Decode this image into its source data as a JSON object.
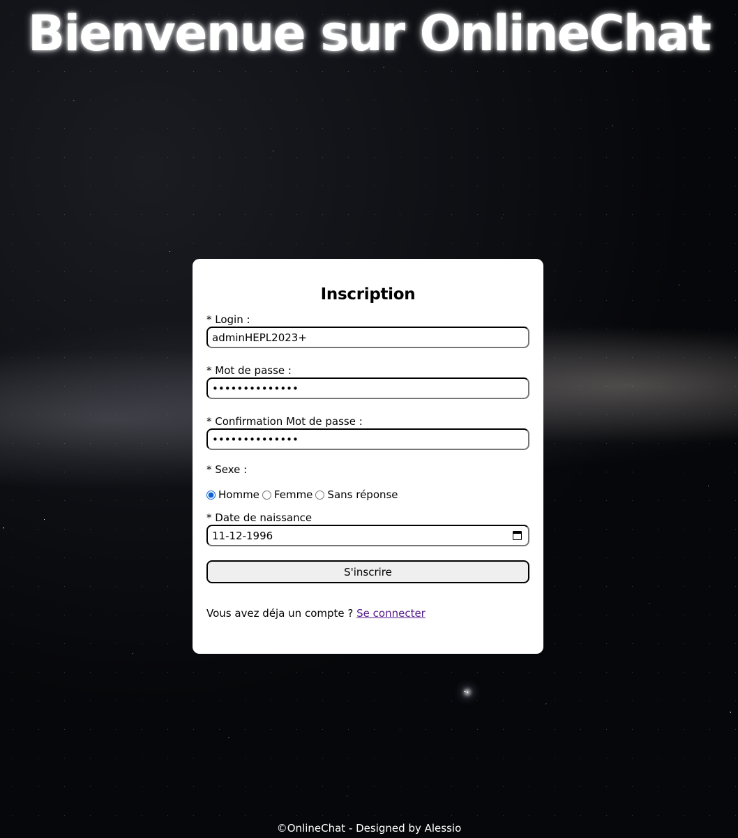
{
  "header": {
    "title": "Bienvenue sur OnlineChat"
  },
  "form": {
    "title": "Inscription",
    "login": {
      "label": "* Login :",
      "value": "adminHEPL2023+"
    },
    "password": {
      "label": "* Mot de passe :",
      "value": "••••••••••••••"
    },
    "password_confirm": {
      "label": "* Confirmation Mot de passe :",
      "value": "••••••••••••••"
    },
    "sexe": {
      "label": "* Sexe :",
      "options": [
        "Homme",
        "Femme",
        "Sans réponse"
      ],
      "selected": "Homme"
    },
    "birthdate": {
      "label": "* Date de naissance",
      "value": "11-12-1996"
    },
    "submit_label": "S'inscrire",
    "login_prompt": "Vous avez déja un compte ?",
    "login_link": "Se connecter"
  },
  "footer": {
    "text": "©OnlineChat - Designed by Alessio"
  },
  "colors": {
    "card_bg": "#ffffff",
    "link": "#551a8b",
    "radio_accent": "#0b63d6",
    "button_bg": "#efefef"
  }
}
